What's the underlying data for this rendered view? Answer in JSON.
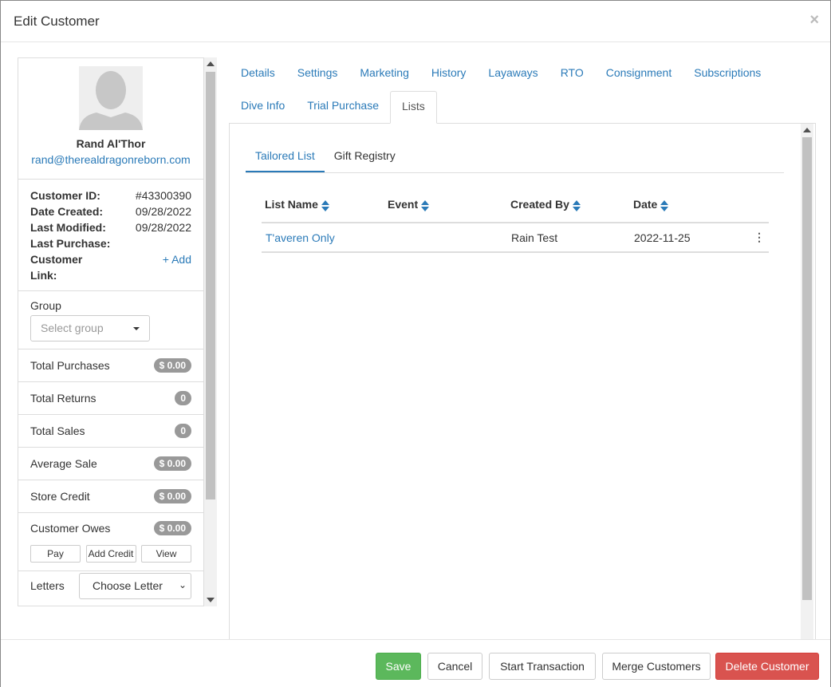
{
  "modal": {
    "title": "Edit Customer",
    "close_symbol": "×"
  },
  "customer": {
    "name": "Rand Al'Thor",
    "email": "rand@therealdragonreborn.com",
    "info": [
      {
        "label": "Customer ID:",
        "value": "#43300390"
      },
      {
        "label": "Date Created:",
        "value": "09/28/2022"
      },
      {
        "label": "Last Modified:",
        "value": "09/28/2022"
      },
      {
        "label": "Last Purchase:",
        "value": ""
      }
    ],
    "link_label": "Customer",
    "link_label2": "Link:",
    "link_action": "+ Add"
  },
  "group": {
    "label": "Group",
    "placeholder": "Select group"
  },
  "stats": [
    {
      "label": "Total Purchases",
      "badge": "$ 0.00"
    },
    {
      "label": "Total Returns",
      "badge": "0"
    },
    {
      "label": "Total Sales",
      "badge": "0"
    },
    {
      "label": "Average Sale",
      "badge": "$ 0.00"
    },
    {
      "label": "Store Credit",
      "badge": "$ 0.00"
    }
  ],
  "owes": {
    "label": "Customer Owes",
    "badge": "$ 0.00",
    "buttons": [
      "Pay",
      "Add Credit",
      "View"
    ]
  },
  "letters": {
    "label": "Letters",
    "select_value": "Choose Letter"
  },
  "tabs": {
    "row1": [
      "Details",
      "Settings",
      "Marketing",
      "History",
      "Layaways",
      "RTO",
      "Consignment",
      "Subscriptions"
    ],
    "row2": [
      "Dive Info",
      "Trial Purchase",
      "Lists"
    ],
    "active": "Lists"
  },
  "subtabs": [
    "Tailored List",
    "Gift Registry"
  ],
  "table": {
    "headers": [
      "List Name",
      "Event",
      "Created By",
      "Date"
    ],
    "rows": [
      {
        "list_name": "T'averen Only",
        "event": "",
        "created_by": "Rain Test",
        "date": "2022-11-25"
      }
    ],
    "kebab": "⋮"
  },
  "footer": {
    "save": "Save",
    "cancel": "Cancel",
    "start_transaction": "Start Transaction",
    "merge": "Merge Customers",
    "delete": "Delete Customer"
  }
}
